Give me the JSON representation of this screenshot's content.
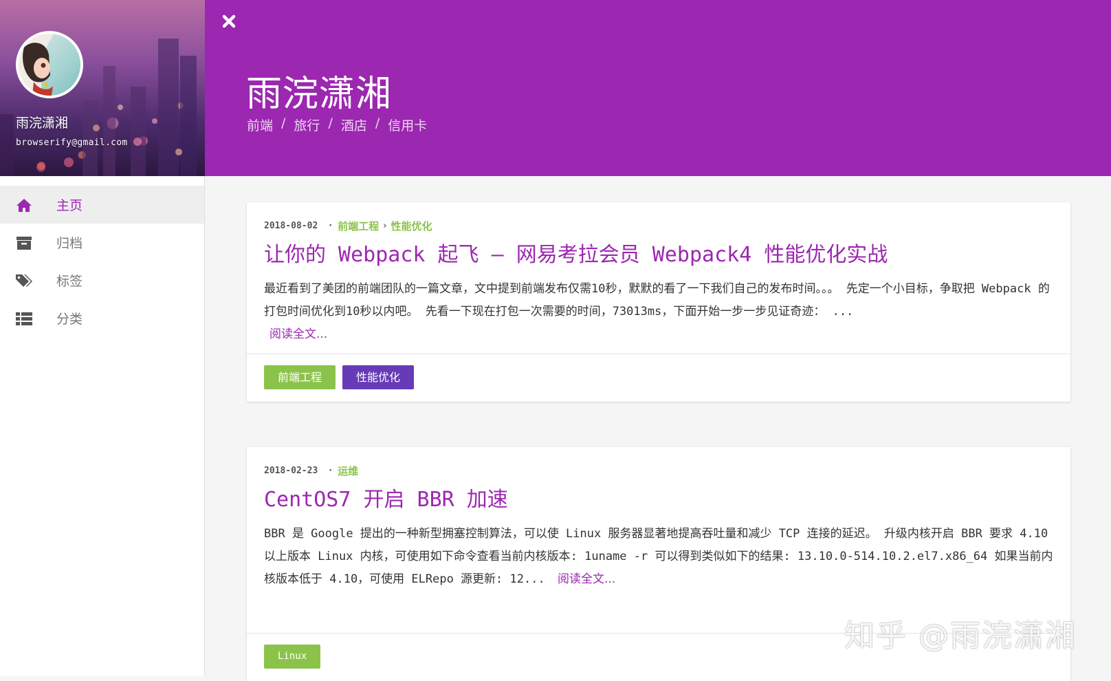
{
  "profile": {
    "name": "雨浣潇湘",
    "email": "browserify@gmail.com"
  },
  "nav": [
    {
      "label": "主页",
      "icon": "home-icon"
    },
    {
      "label": "归档",
      "icon": "archive-icon"
    },
    {
      "label": "标签",
      "icon": "tags-icon"
    },
    {
      "label": "分类",
      "icon": "list-icon"
    }
  ],
  "header": {
    "title": "雨浣潇湘",
    "subtitle_items": [
      "前端",
      "旅行",
      "酒店",
      "信用卡"
    ],
    "separator": "/"
  },
  "posts": [
    {
      "date": "2018-08-02",
      "dot": "·",
      "categories": [
        "前端工程",
        "性能优化"
      ],
      "category_chevron": "›",
      "title": "让你的 Webpack 起飞 — 网易考拉会员 Webpack4 性能优化实战",
      "excerpt": "最近看到了美团的前端团队的一篇文章，文中提到前端发布仅需10秒，默默的看了一下我们自己的发布时间。。。 先定一个小目标，争取把 Webpack 的打包时间优化到10秒以内吧。 先看一下现在打包一次需要的时间，73013ms，下面开始一步一步见证奇迹： ...",
      "read_more": "阅读全文...",
      "tags": [
        {
          "label": "前端工程",
          "color": "#8bc34a"
        },
        {
          "label": "性能优化",
          "color": "#673ab7"
        }
      ]
    },
    {
      "date": "2018-02-23",
      "dot": "·",
      "categories": [
        "运维"
      ],
      "title": "CentOS7 开启 BBR 加速",
      "excerpt": "BBR 是 Google 提出的一种新型拥塞控制算法，可以使 Linux 服务器显著地提高吞吐量和减少 TCP 连接的延迟。 升级内核开启 BBR 要求 4.10 以上版本 Linux 内核，可使用如下命令查看当前内核版本: 1uname -r 可以得到类似如下的结果: 13.10.0-514.10.2.el7.x86_64 如果当前内核版本低于 4.10，可使用 ELRepo 源更新: 12...",
      "read_more": "阅读全文...",
      "tags": [
        {
          "label": "Linux",
          "color": "#8bc34a"
        }
      ]
    }
  ],
  "watermark": "知乎 @雨浣潇湘",
  "colors": {
    "primary": "#9c27b0",
    "green": "#8bc34a",
    "deep_purple": "#673ab7"
  }
}
